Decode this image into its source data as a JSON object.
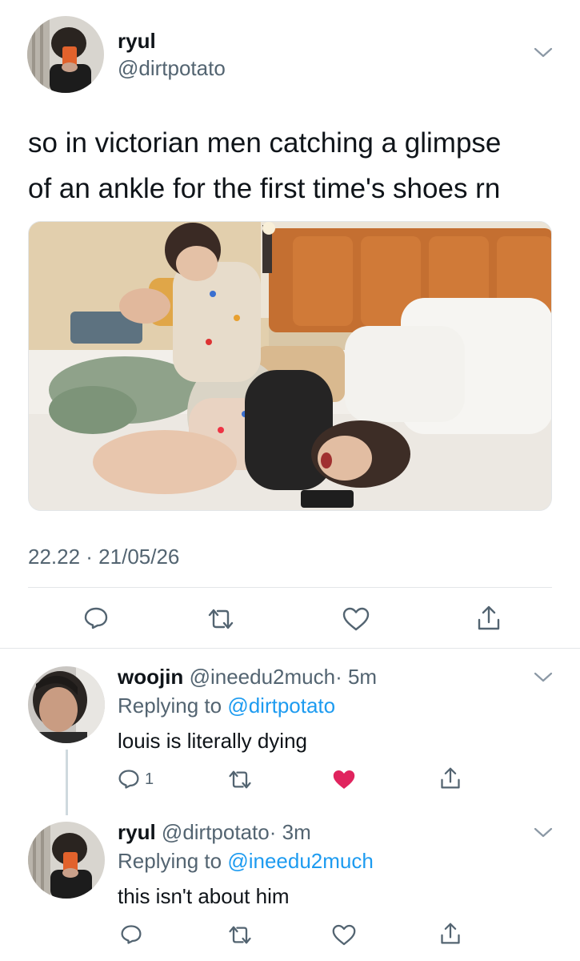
{
  "main_tweet": {
    "display_name": "ryul",
    "handle": "@dirtpotato",
    "text_line1": "so in victorian men catching a glimpse",
    "text_line2": "of an ankle for the first time's shoes rn",
    "timestamp": "22.22 · 21/05/26",
    "actions": [
      "reply-icon",
      "retweet-icon",
      "like-icon",
      "share-icon"
    ]
  },
  "replies": [
    {
      "display_name": "woojin",
      "handle": "@ineedu2much",
      "time": "· 5m",
      "replying_prefix": "Replying to",
      "replying_to": "@dirtpotato",
      "text": "louis is literally dying",
      "reply_count": "1",
      "liked": true
    },
    {
      "display_name": "ryul",
      "handle": "@dirtpotato",
      "time": "· 3m",
      "replying_prefix": "Replying to",
      "replying_to": "@ineedu2much",
      "text": "this isn't about him",
      "reply_count": "",
      "liked": false
    }
  ],
  "colors": {
    "text": "#0f1419",
    "secondary": "#536471",
    "link": "#1d9bf0",
    "like": "#e0245e",
    "divider": "#e3e6e8"
  }
}
